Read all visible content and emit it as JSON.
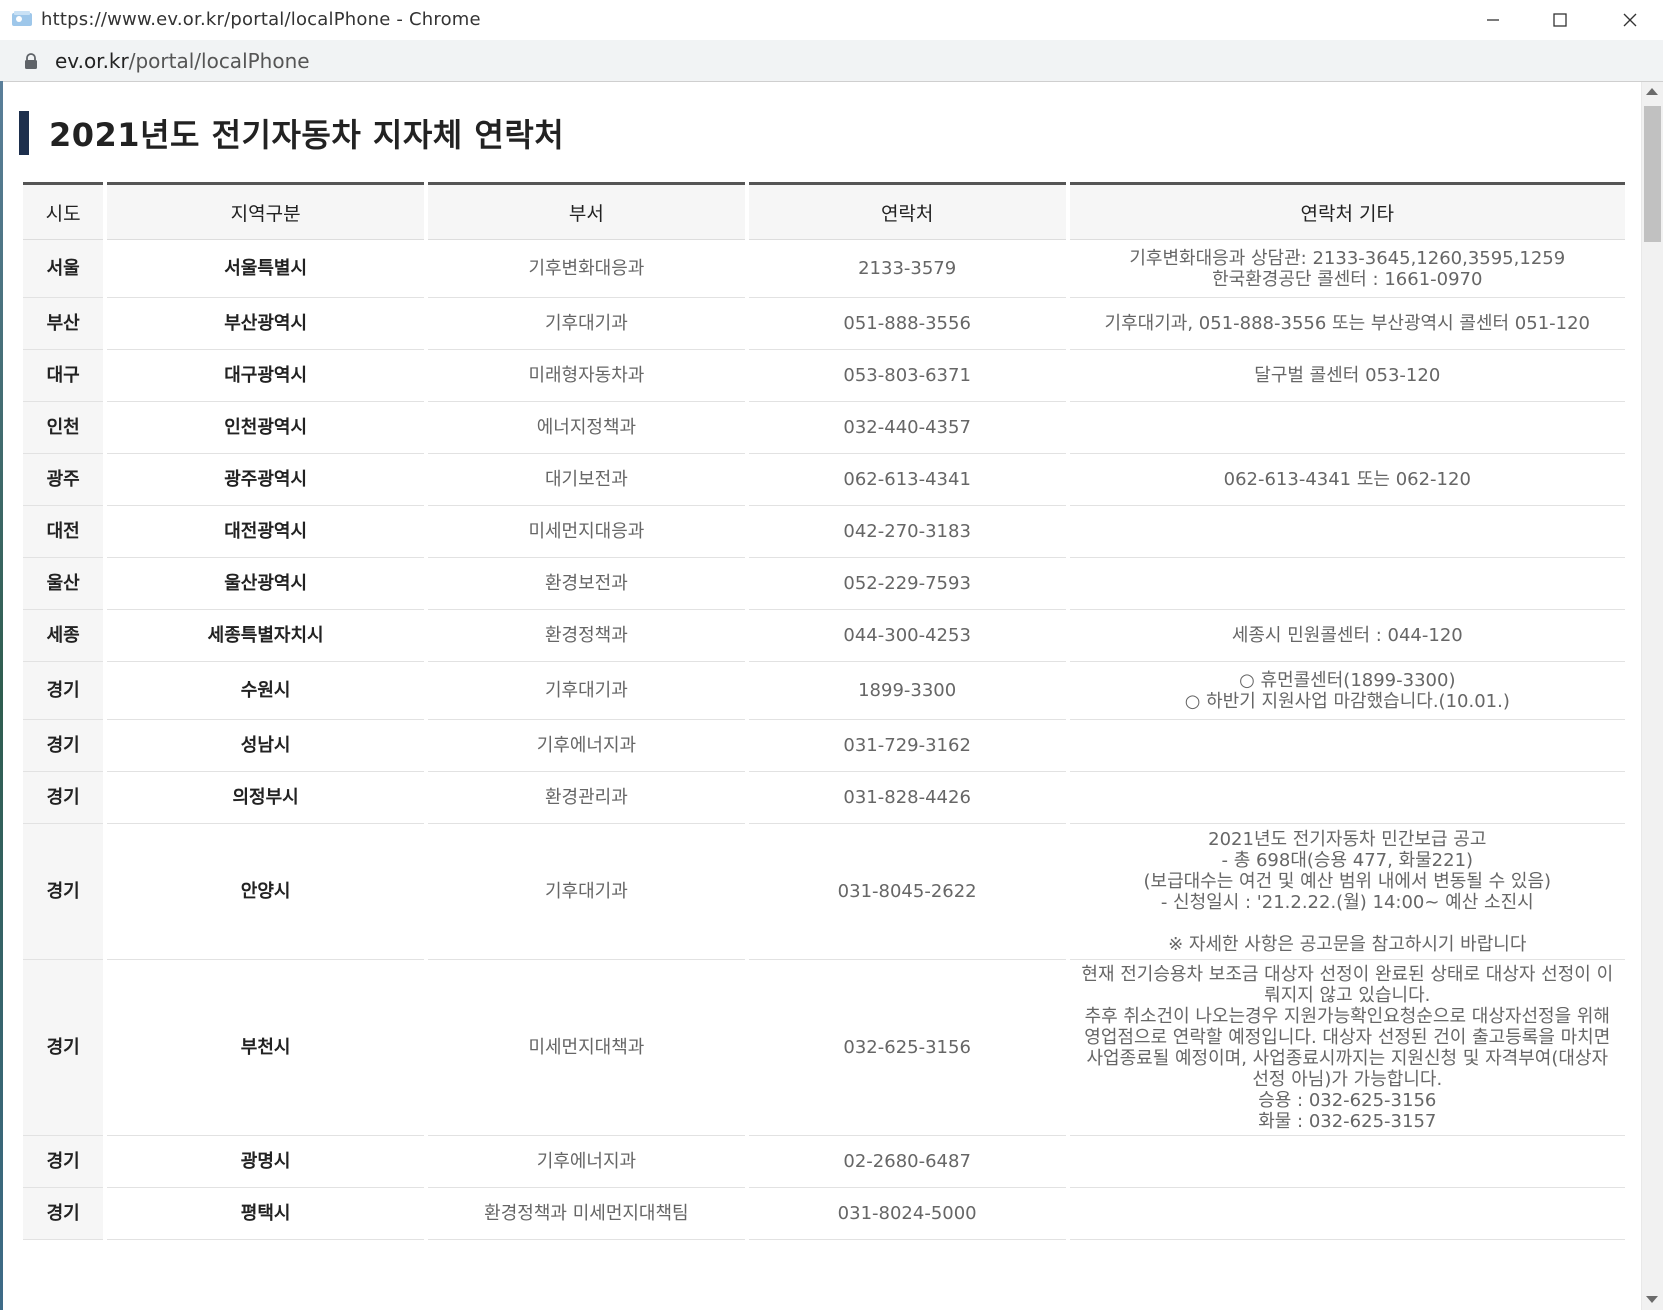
{
  "window": {
    "title": "https://www.ev.or.kr/portal/localPhone - Chrome",
    "url_host": "ev.or.kr",
    "url_path": "/portal/localPhone"
  },
  "page": {
    "heading": "2021년도 전기자동차 지자체 연락처"
  },
  "table": {
    "headers": [
      "시도",
      "지역구분",
      "부서",
      "연락처",
      "연락처 기타"
    ],
    "rows": [
      {
        "sido": "서울",
        "region": "서울특별시",
        "dept": "기후변화대응과",
        "phone": "2133-3579",
        "note": "기후변화대응과 상담관: 2133-3645,1260,3595,1259\n한국환경공단 콜센터 : 1661-0970"
      },
      {
        "sido": "부산",
        "region": "부산광역시",
        "dept": "기후대기과",
        "phone": "051-888-3556",
        "note": "기후대기과, 051-888-3556 또는 부산광역시 콜센터 051-120"
      },
      {
        "sido": "대구",
        "region": "대구광역시",
        "dept": "미래형자동차과",
        "phone": "053-803-6371",
        "note": "달구벌 콜센터 053-120"
      },
      {
        "sido": "인천",
        "region": "인천광역시",
        "dept": "에너지정책과",
        "phone": "032-440-4357",
        "note": ""
      },
      {
        "sido": "광주",
        "region": "광주광역시",
        "dept": "대기보전과",
        "phone": "062-613-4341",
        "note": "062-613-4341 또는 062-120"
      },
      {
        "sido": "대전",
        "region": "대전광역시",
        "dept": "미세먼지대응과",
        "phone": "042-270-3183",
        "note": ""
      },
      {
        "sido": "울산",
        "region": "울산광역시",
        "dept": "환경보전과",
        "phone": "052-229-7593",
        "note": ""
      },
      {
        "sido": "세종",
        "region": "세종특별자치시",
        "dept": "환경정책과",
        "phone": "044-300-4253",
        "note": "세종시 민원콜센터 : 044-120"
      },
      {
        "sido": "경기",
        "region": "수원시",
        "dept": "기후대기과",
        "phone": "1899-3300",
        "note": "○ 휴먼콜센터(1899-3300)\n○ 하반기 지원사업 마감했습니다.(10.01.)"
      },
      {
        "sido": "경기",
        "region": "성남시",
        "dept": "기후에너지과",
        "phone": "031-729-3162",
        "note": ""
      },
      {
        "sido": "경기",
        "region": "의정부시",
        "dept": "환경관리과",
        "phone": "031-828-4426",
        "note": ""
      },
      {
        "sido": "경기",
        "region": "안양시",
        "dept": "기후대기과",
        "phone": "031-8045-2622",
        "note": "2021년도 전기자동차 민간보급 공고\n- 총 698대(승용 477, 화물221)\n(보급대수는 여건 및 예산 범위 내에서 변동될 수 있음)\n- 신청일시 : '21.2.22.(월) 14:00~ 예산 소진시\n\n※ 자세한 사항은 공고문을 참고하시기 바랍니다"
      },
      {
        "sido": "경기",
        "region": "부천시",
        "dept": "미세먼지대책과",
        "phone": "032-625-3156",
        "note": "현재 전기승용차 보조금 대상자 선정이 완료된 상태로 대상자 선정이 이뤄지지 않고 있습니다.\n추후 취소건이 나오는경우 지원가능확인요청순으로 대상자선정을 위해 영업점으로 연락할 예정입니다. 대상자 선정된 건이 출고등록을 마치면 사업종료될 예정이며, 사업종료시까지는 지원신청 및 자격부여(대상자 선정 아님)가 가능합니다.\n승용 : 032-625-3156\n화물 : 032-625-3157"
      },
      {
        "sido": "경기",
        "region": "광명시",
        "dept": "기후에너지과",
        "phone": "02-2680-6487",
        "note": ""
      },
      {
        "sido": "경기",
        "region": "평택시",
        "dept": "환경정책과 미세먼지대책팀",
        "phone": "031-8024-5000",
        "note": ""
      }
    ]
  },
  "icons": {
    "app": "chrome-app-icon",
    "lock": "lock-icon",
    "minimize": "minimize-icon",
    "maximize": "maximize-icon",
    "close": "close-icon"
  },
  "colors": {
    "heading_bar": "#1d2f4d",
    "header_border": "#555555",
    "sido_bg": "#f6f6f6"
  }
}
